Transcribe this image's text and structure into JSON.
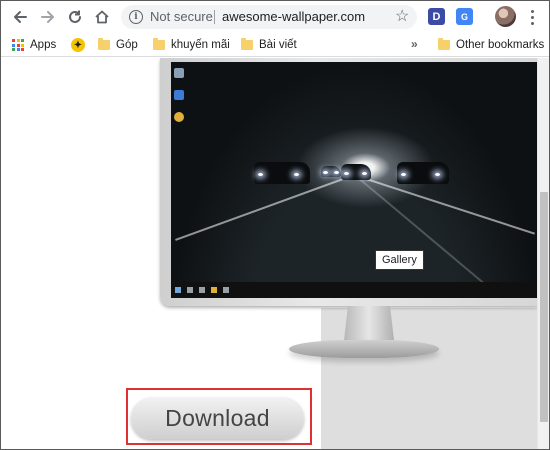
{
  "browser": {
    "omnibox": {
      "security_label": "Not secure",
      "url": "awesome-wallpaper.com"
    },
    "extensions": [
      "D",
      "G"
    ]
  },
  "bookmarks": {
    "items": [
      {
        "label": "Apps",
        "icon": "apps-grid-icon"
      },
      {
        "label": "",
        "icon": "gop-icon"
      },
      {
        "label": "Góp",
        "icon": "folder-icon"
      },
      {
        "label": "khuyến mãi",
        "icon": "folder-icon"
      },
      {
        "label": "Bài viết",
        "icon": "folder-icon"
      }
    ],
    "overflow": "»",
    "other": "Other bookmarks"
  },
  "page": {
    "tooltip": "Gallery",
    "download_label": "Download"
  },
  "colors": {
    "highlight": "#e03030",
    "folder": "#f6d06a"
  }
}
